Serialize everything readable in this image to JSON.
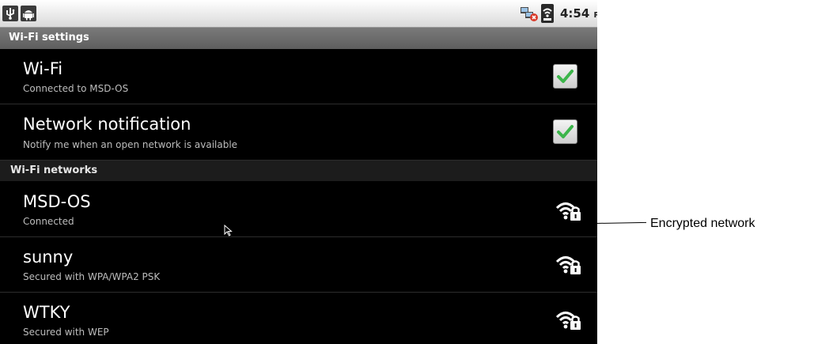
{
  "status_bar": {
    "time": "4:54",
    "ampm": "PM",
    "icons": [
      "usb-icon",
      "android-debug-icon",
      "no-data-connection-icon",
      "signal-icon"
    ]
  },
  "title": "Wi-Fi settings",
  "settings": [
    {
      "title": "Wi-Fi",
      "summary": "Connected to MSD-OS",
      "checked": true
    },
    {
      "title": "Network notification",
      "summary": "Notify me when an open network is available",
      "checked": true
    }
  ],
  "networks_header": "Wi-Fi networks",
  "networks": [
    {
      "ssid": "MSD-OS",
      "status": "Connected",
      "icon": "wifi-lock-icon"
    },
    {
      "ssid": "sunny",
      "status": "Secured with WPA/WPA2 PSK",
      "icon": "wifi-lock-icon"
    },
    {
      "ssid": "WTKY",
      "status": "Secured with WEP",
      "icon": "wifi-lock-icon"
    }
  ],
  "annotation": {
    "label": "Encrypted network"
  },
  "colors": {
    "checkmark": "#3cb54a",
    "background": "#000000",
    "title_bar": "#6b6b6b"
  }
}
